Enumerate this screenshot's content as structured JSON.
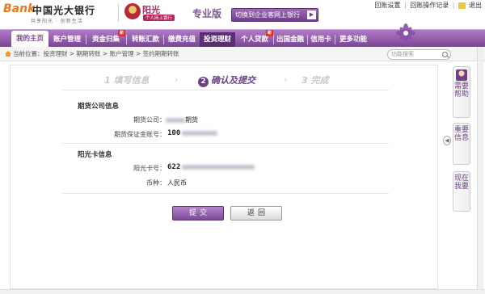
{
  "header": {
    "logo_en": "Bank",
    "bank_name": "中国光大银行",
    "slogan": "共享阳光 · 创新生活",
    "brand": "阳光",
    "brand_sub": "个人网上银行",
    "edition": "专业版",
    "switch_label": "切换到企业客网上银行",
    "switch_arrow": "▶",
    "links": [
      "回账设置",
      "回账操作记录",
      "退出"
    ],
    "link_sep": "|"
  },
  "nav": {
    "items": [
      "我的主页",
      "账户管理",
      "资金归集",
      "转账汇款",
      "缴费充值",
      "投资理财",
      "个人贷款",
      "出国金融",
      "信用卡",
      "更多功能"
    ],
    "new_badge": "新"
  },
  "breadcrumb": {
    "text": "当前位置：投资理财 > 期期转账 > 账户管理 > 签约期期转账"
  },
  "search": {
    "placeholder": "功能搜索"
  },
  "steps": {
    "step1": "1 填写信息",
    "step2_num": "2",
    "step2": "确认及提交",
    "step3": "3 完成",
    "arrow": "›"
  },
  "futures": {
    "title": "期货公司信息",
    "company_label": "期货公司：",
    "company_suffix": "期货",
    "account_label": "期货保证金账号：",
    "account_prefix": "100"
  },
  "card": {
    "title": "阳光卡信息",
    "card_label": "阳光卡号：",
    "card_prefix": "622",
    "currency_label": "币种：",
    "currency_value": "人民币"
  },
  "buttons": {
    "submit": "提交",
    "back": "返回"
  },
  "side": {
    "collapse": "◀",
    "help": "需要帮助",
    "important": "重要信息",
    "now": "现在我要"
  },
  "colors": {
    "brand_purple": "#7a4594",
    "accent_orange": "#e87a1e"
  }
}
